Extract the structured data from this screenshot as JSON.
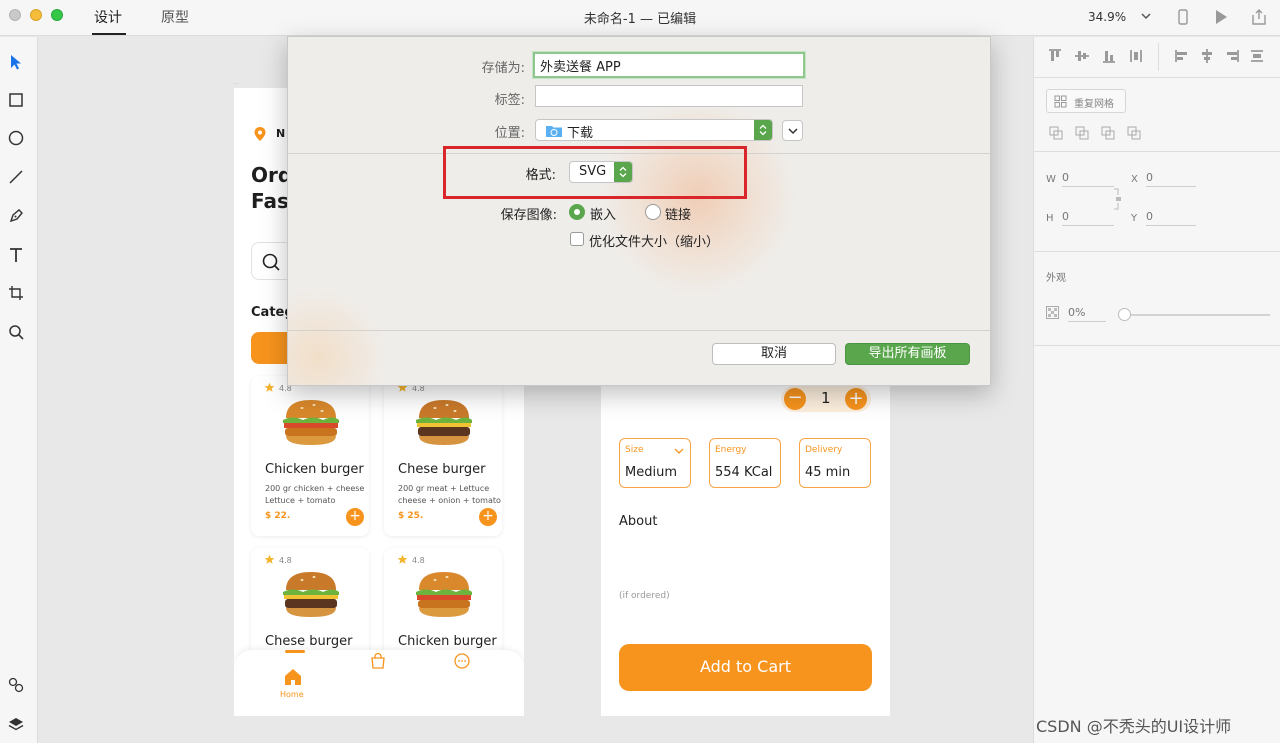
{
  "titlebar": {
    "tab_design": "设计",
    "tab_prototype": "原型",
    "doc_title": "未命名-1 — 已编辑",
    "zoom": "34.9%"
  },
  "artboard_left": {
    "location_text": "N",
    "heading_line1": "Ord",
    "heading_line2": "Fas",
    "category_label": "Categ",
    "cards": [
      {
        "rating": "4.8",
        "name": "Chicken burger",
        "desc1": "200 gr chicken + cheese",
        "desc2": "Lettuce + tomato",
        "price": "$ 22."
      },
      {
        "rating": "4.8",
        "name": "Chese burger",
        "desc1": "200 gr meat + Lettuce",
        "desc2": "cheese + onion + tomato",
        "price": "$ 25."
      },
      {
        "rating": "4.8",
        "name": "Chese burger",
        "desc1": "",
        "desc2": "",
        "price": ""
      },
      {
        "rating": "4.8",
        "name": "Chicken burger",
        "desc1": "",
        "desc2": "",
        "price": ""
      }
    ],
    "nav_home": "Home"
  },
  "artboard_right": {
    "quantity": "1",
    "size_label": "Size",
    "size_value": "Medium",
    "energy_label": "Energy",
    "energy_value": "554 KCal",
    "delivery_label": "Delivery",
    "delivery_value": "45 min",
    "about_title": "About",
    "note": "(if ordered)",
    "add_to_cart": "Add to Cart"
  },
  "dialog": {
    "save_as_label": "存储为:",
    "save_as_value": "外卖送餐 APP",
    "tags_label": "标签:",
    "tags_value": "",
    "location_label": "位置:",
    "location_value": "下载",
    "format_label": "格式:",
    "format_value": "SVG",
    "save_images_label": "保存图像:",
    "radio_embed": "嵌入",
    "radio_link": "链接",
    "optimize_label": "优化文件大小（缩小）",
    "cancel": "取消",
    "export": "导出所有画板"
  },
  "right_panel": {
    "repeat_grid": "重复网格",
    "w_label": "W",
    "w_value": "0",
    "x_label": "X",
    "x_value": "0",
    "h_label": "H",
    "h_value": "0",
    "y_label": "Y",
    "y_value": "0",
    "appearance_title": "外观",
    "opacity_value": "0%"
  },
  "watermark": "CSDN @不秃头的UI设计师",
  "colors": {
    "brand_orange": "#f7941d",
    "export_green": "#5aa64c",
    "highlight_red": "#d9262a"
  }
}
